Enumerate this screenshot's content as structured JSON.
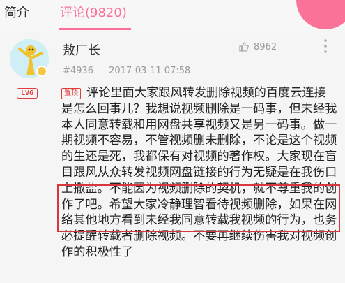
{
  "tabs": [
    {
      "label": "简介"
    },
    {
      "label": "评论(9820)"
    }
  ],
  "comment": {
    "username": "敖厂长",
    "level": "LV6",
    "floor": "#4936",
    "datetime": "2017-03-11 07:58",
    "likes": "8962",
    "pin_label": "置顶",
    "text": "评论里面大家跟风转发删除视频的百度云连接是怎么回事儿？我想说视频删除是一码事，但未经我本人同意转载和用网盘共享视频又是另一码事。做一期视频不容易，不管视频删未删除，不论是这个视频的生还是死，我都保有对视频的著作权。大家现在盲目跟风从众转发视频网盘链接的行为无疑是在我伤口上撒盐。不能因为视频删除的契机，就不尊重我的创作了吧。希望大家冷静理智看待视频删除，如果在网络其他地方看到未经我同意转载我视频的行为，也务必提醒转载者删除视频。不要再继续伤害我对视频创作的积极性了"
  },
  "colors": {
    "accent": "#fb7299",
    "highlight_border": "#d9363e",
    "level_badge": "#e23b3b"
  }
}
